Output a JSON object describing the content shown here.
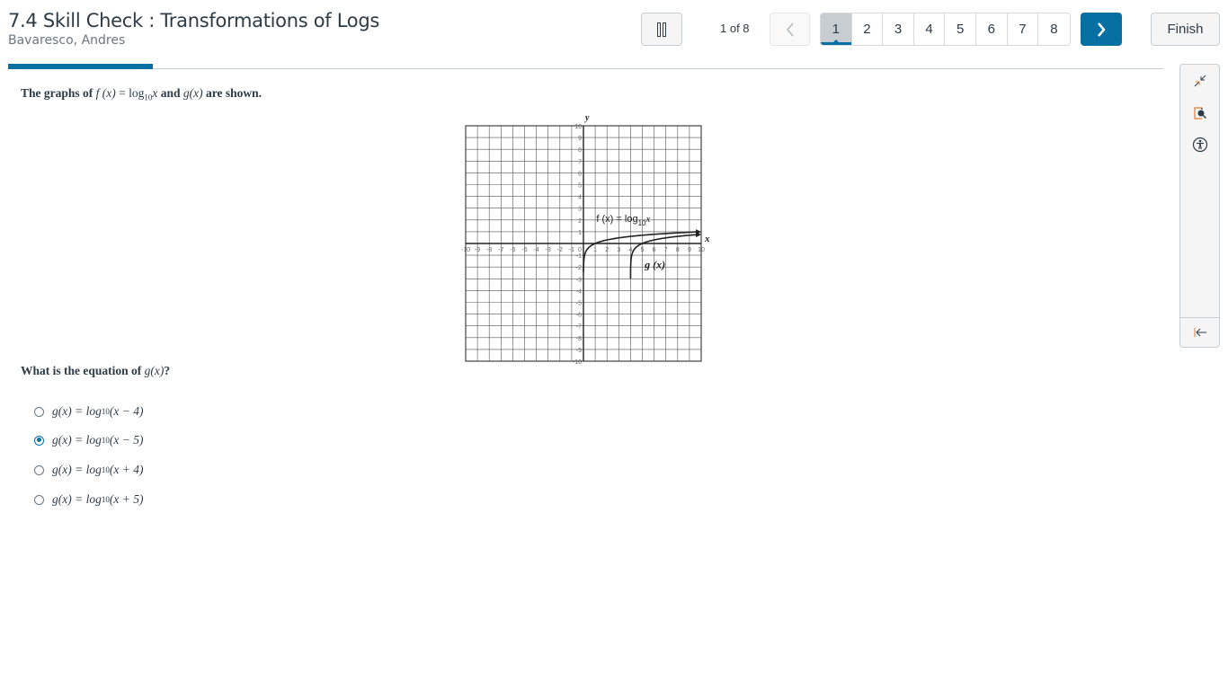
{
  "header": {
    "title": "7.4 Skill Check : Transformations of Logs",
    "student": "Bavaresco, Andres"
  },
  "progress": {
    "fraction": 0.125,
    "color": "#0770a3"
  },
  "nav": {
    "page_count": "1 of 8",
    "pages": [
      "1",
      "2",
      "3",
      "4",
      "5",
      "6",
      "7",
      "8"
    ],
    "current_page": "1",
    "finish_label": "Finish",
    "pause_icon": "pause-icon",
    "prev_icon": "chevron-left-icon",
    "next_icon": "chevron-right-icon"
  },
  "side_tools": [
    {
      "icon": "collapse-arrows-icon"
    },
    {
      "icon": "magnifier-icon"
    },
    {
      "icon": "accessibility-icon"
    },
    {
      "icon": "collapse-panel-icon"
    }
  ],
  "question": {
    "prompt": {
      "pre": "The graphs of ",
      "f": "f (x)",
      "eq": " = log",
      "base": "10",
      "arg": "x",
      "mid": " and ",
      "g": "g(x)",
      "post": " are shown."
    },
    "ask": {
      "pre": "What is the equation of ",
      "g": "g(x)",
      "post": "?"
    },
    "options": [
      {
        "lhs": "g(x) = log",
        "base": "10",
        "arg": "(x − 4)",
        "selected": false
      },
      {
        "lhs": "g(x) = log",
        "base": "10",
        "arg": "(x − 5)",
        "selected": true
      },
      {
        "lhs": "g(x) = log",
        "base": "10",
        "arg": "(x + 4)",
        "selected": false
      },
      {
        "lhs": "g(x) = log",
        "base": "10",
        "arg": "(x + 5)",
        "selected": false
      }
    ]
  },
  "graph": {
    "x_label": "x",
    "y_label": "y",
    "x_ticks": [
      "-10",
      "-9",
      "-8",
      "-7",
      "-6",
      "-5",
      "-4",
      "-3",
      "-2",
      "-1",
      "0",
      "1",
      "2",
      "3",
      "4",
      "5",
      "6",
      "7",
      "8",
      "9",
      "10"
    ],
    "y_ticks": [
      "10",
      "9",
      "8",
      "7",
      "6",
      "5",
      "4",
      "3",
      "2",
      "1",
      "-1",
      "-2",
      "-3",
      "-4",
      "-5",
      "-6",
      "-7",
      "-8",
      "-9",
      "-10"
    ],
    "f_label": "f (x) = log",
    "f_label_base": "10",
    "f_label_arg": "x",
    "g_label": "g (x)",
    "xlim": [
      -10,
      10
    ],
    "ylim": [
      -10,
      10
    ],
    "f_shift": 0,
    "g_shift": 4
  }
}
